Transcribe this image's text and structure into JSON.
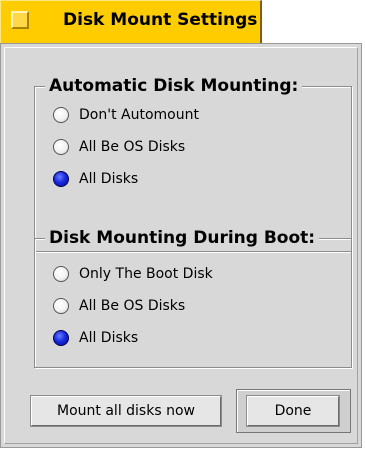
{
  "window": {
    "title": "Disk Mount Settings"
  },
  "automatic_mounting": {
    "heading": "Automatic Disk Mounting:",
    "options": [
      {
        "label": "Don't Automount",
        "selected": false
      },
      {
        "label": "All Be OS Disks",
        "selected": false
      },
      {
        "label": "All Disks",
        "selected": true
      }
    ]
  },
  "boot_mounting": {
    "heading": "Disk Mounting During Boot:",
    "options": [
      {
        "label": "Only The Boot Disk",
        "selected": false
      },
      {
        "label": "All Be OS Disks",
        "selected": false
      },
      {
        "label": "All Disks",
        "selected": true
      }
    ]
  },
  "buttons": {
    "mount_now": "Mount all disks now",
    "done": "Done"
  },
  "colors": {
    "title_tab": "#ffcc00",
    "panel": "#d8d8d8",
    "radio_selected": "#1a2be0"
  }
}
